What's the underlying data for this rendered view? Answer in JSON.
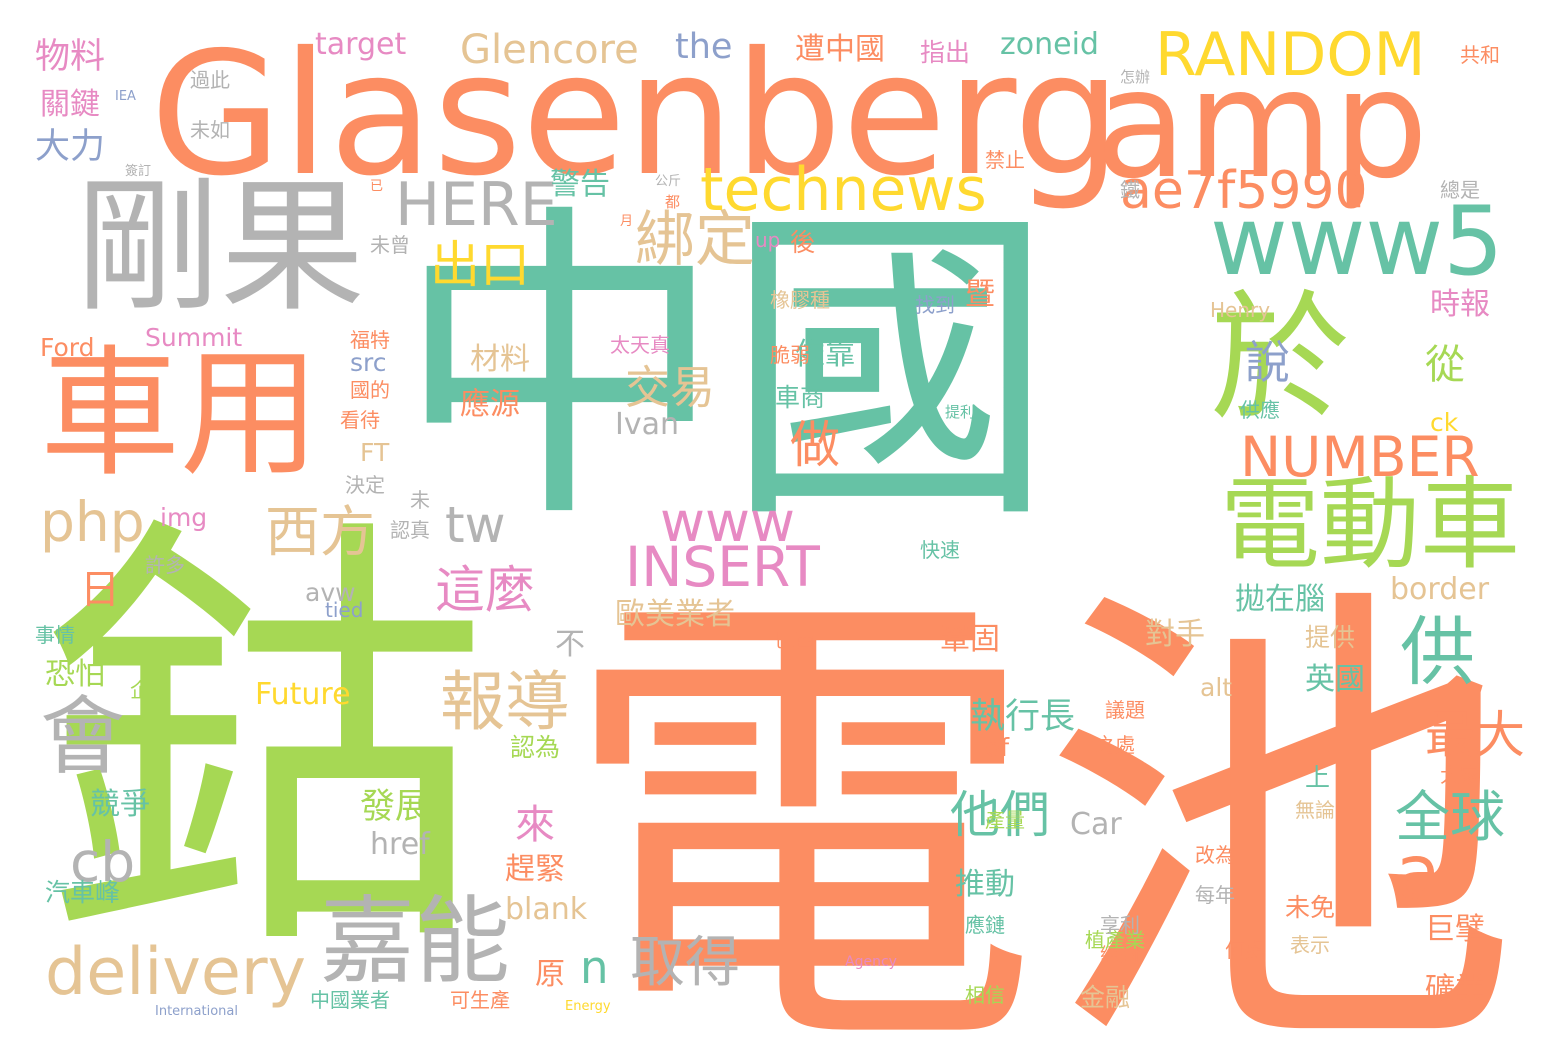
{
  "palette": {
    "teal": "#66c2a5",
    "orange": "#fc8d62",
    "green": "#a6d854",
    "gray": "#b3b3b3",
    "tan": "#e5c494",
    "yellow": "#ffd92f",
    "pink": "#e78ac3",
    "blue": "#8da0cb"
  },
  "words": [
    "中國",
    "電池",
    "鈷",
    "Glasenberg",
    "amp",
    "剛果",
    "車用",
    "於",
    "電動車",
    "www5",
    "technews",
    "RANDOM",
    "ae7f5990",
    "嘉能",
    "delivery",
    "會",
    "php",
    "cb",
    "供",
    "報導",
    "a",
    "綁定",
    "HERE",
    "出口",
    "西方",
    "tw",
    "www",
    "INSERT",
    "NUMBER",
    "全球",
    "他們",
    "取得",
    "這麼",
    "最大",
    "交易",
    "做",
    "說",
    "從",
    "日",
    "n",
    "Glencore",
    "the",
    "target",
    "zoneid",
    "遭中國",
    "指出",
    "物料",
    "關鍵",
    "大力",
    "警告",
    "時報",
    "依靠",
    "材料",
    "應源",
    "Ivan",
    "src",
    "FT",
    "暨",
    "找到",
    "Summit",
    "Ford",
    "img",
    "avw",
    "tied",
    "歐美業者",
    "拋在腦",
    "對手",
    "提供",
    "英國",
    "競爭",
    "恐怕",
    "Future",
    "發展",
    "來",
    "執行長",
    "鞏固",
    "of",
    "認為",
    "趕緊",
    "href",
    "推動",
    "Car",
    "上",
    "無論",
    "產量",
    "巨擘",
    "礦業",
    "原",
    "blank",
    "金融",
    "未免",
    "border",
    "alt",
    "ck",
    "車商",
    "供應",
    "Henry",
    "up",
    "後",
    "太天真",
    "許多",
    "汽車峰",
    "事情",
    "企業",
    "中國業者",
    "可生產",
    "相信",
    "絕對",
    "表示",
    "何處",
    "植產業",
    "應鏈",
    "享利",
    "每年",
    "改為",
    "大家",
    "議題",
    "之處",
    "總是",
    "鐵",
    "禁止",
    "怎辦",
    "共和",
    "未曾",
    "未如",
    "過此",
    "橡膠種",
    "脆弱",
    "福特",
    "國的",
    "看待",
    "決定",
    "未",
    "認真",
    "巴西",
    "不",
    "快速",
    "提利",
    "Agency",
    "Energy",
    "International",
    "IEA",
    "公斤",
    "月",
    "都",
    "已",
    "簽訂"
  ]
}
